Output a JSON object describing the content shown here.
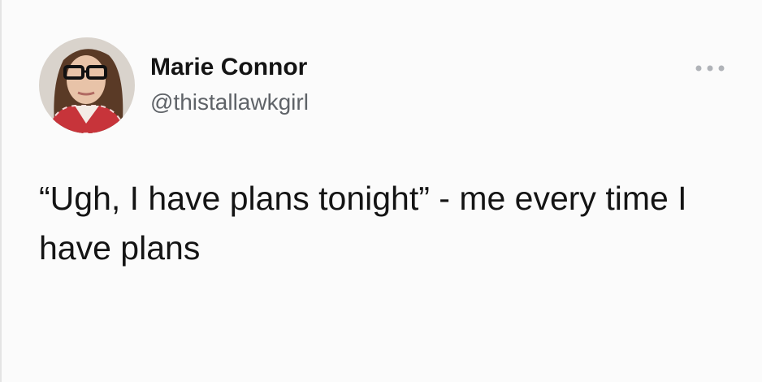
{
  "tweet": {
    "author": {
      "display_name": "Marie Connor",
      "handle": "@thistallawkgirl",
      "avatar": "profile-photo"
    },
    "text": "“Ugh, I have plans tonight” - me every time I have plans",
    "more_icon": "more-horizontal-icon"
  },
  "colors": {
    "background": "#fbfbfb",
    "text": "#141414",
    "handle": "#5f6368",
    "icon": "#b0b3b8"
  }
}
